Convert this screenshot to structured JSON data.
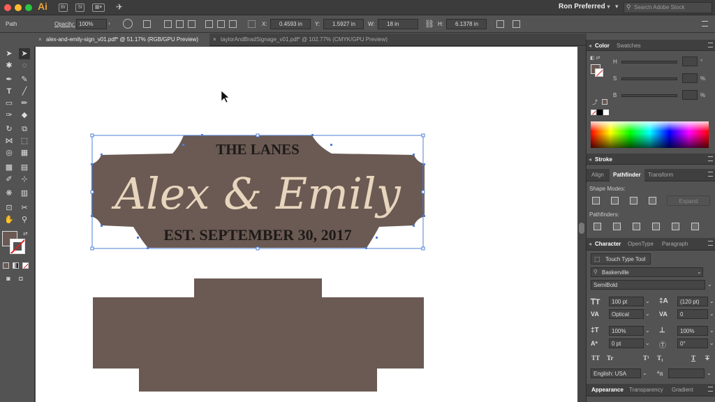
{
  "app": {
    "logo": "Ai",
    "workspace": "Ron Preferred",
    "stock_search_placeholder": "Search Adobe Stock",
    "bridge_icon": "Br",
    "stock_icon": "St"
  },
  "control_bar": {
    "selection_type": "Path",
    "opacity_label": "Opacity:",
    "opacity_value": "100%",
    "x_label": "X:",
    "x_value": "0.4593 in",
    "y_label": "Y:",
    "y_value": "1.5927 in",
    "w_label": "W:",
    "w_value": "18 in",
    "h_label": "H:",
    "h_value": "6.1378 in"
  },
  "tabs": [
    {
      "label": "alex-and-emily-sign_v01.pdf* @ 51.17% (RGB/GPU Preview)",
      "active": true
    },
    {
      "label": "taylorAndBradSignage_v01.pdf* @ 102.77% (CMYK/GPU Preview)",
      "active": false
    }
  ],
  "artwork": {
    "top_line": "THE LANES",
    "names": "Alex & Emily",
    "bottom_line": "EST. SEPTEMBER 30, 2017",
    "sign_color": "#6a5a53",
    "text_cream": "#e8d5bd",
    "text_dark": "#1e1a18"
  },
  "color_panel": {
    "tabs": [
      "Color",
      "Swatches"
    ],
    "h_label": "H",
    "s_label": "S",
    "b_label": "B",
    "h_unit": "°",
    "s_unit": "%",
    "b_unit": "%"
  },
  "stroke_panel": {
    "title": "Stroke"
  },
  "pathfinder_panel": {
    "tabs": [
      "Align",
      "Pathfinder",
      "Transform"
    ],
    "shape_modes_label": "Shape Modes:",
    "expand_label": "Expand",
    "pathfinders_label": "Pathfinders:"
  },
  "character_panel": {
    "tabs": [
      "Character",
      "OpenType",
      "Paragraph"
    ],
    "touch_type": "Touch Type Tool",
    "font_family": "Baskerville",
    "font_style": "SemiBold",
    "font_size": "100 pt",
    "leading": "(120 pt)",
    "kerning": "Optical",
    "tracking": "0",
    "vscale": "100%",
    "hscale": "100%",
    "baseline": "0 pt",
    "rotation": "0°",
    "caps1": "TT",
    "caps2": "Tr",
    "super": "T¹",
    "sub": "T₁",
    "underline": "T",
    "strike": "T",
    "language": "English: USA",
    "aa_label": "ªa"
  },
  "appearance_panel": {
    "tabs": [
      "Appearance",
      "Transparency",
      "Gradient"
    ]
  }
}
